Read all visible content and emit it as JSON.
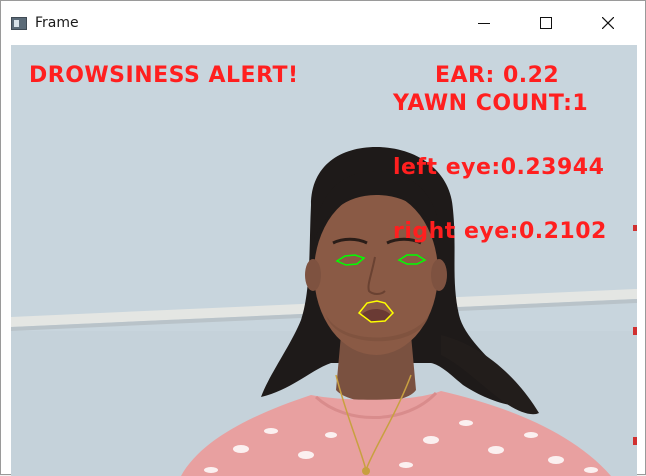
{
  "window": {
    "title": "Frame",
    "controls": [
      "minimize",
      "maximize",
      "close"
    ],
    "icon": "window-app-icon"
  },
  "overlay": {
    "alert": "DROWSINESS ALERT!",
    "ear": "EAR: 0.22",
    "yawn_count": "YAWN COUNT:1",
    "left_eye": "left eye:0.23944",
    "right_eye": "right eye:0.2102"
  },
  "colors": {
    "overlay_text": "#ff1f1f",
    "eye_contour": "#00ff00",
    "mouth_contour": "#ffff00"
  }
}
